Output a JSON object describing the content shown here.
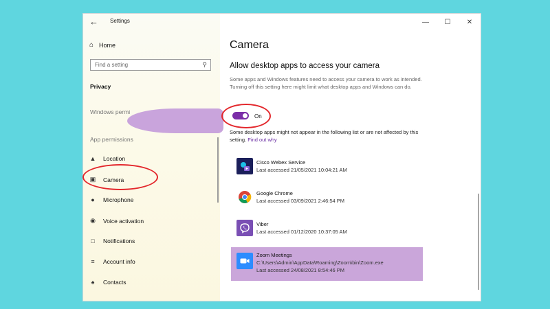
{
  "window": {
    "title": "Settings",
    "controls": {
      "minimize": "—",
      "maximize": "☐",
      "close": "✕"
    }
  },
  "sidebar": {
    "home_label": "Home",
    "search_placeholder": "Find a setting",
    "section_privacy": "Privacy",
    "section_windows_permissions": "Windows permi",
    "section_app_permissions": "App permissions",
    "items": [
      {
        "label": "Location",
        "icon": "location-icon"
      },
      {
        "label": "Camera",
        "icon": "camera-icon"
      },
      {
        "label": "Microphone",
        "icon": "microphone-icon"
      },
      {
        "label": "Voice activation",
        "icon": "voice-activation-icon"
      },
      {
        "label": "Notifications",
        "icon": "notifications-icon"
      },
      {
        "label": "Account info",
        "icon": "account-info-icon"
      },
      {
        "label": "Contacts",
        "icon": "contacts-icon"
      }
    ]
  },
  "main": {
    "title": "Camera",
    "heading": "Allow desktop apps to access your camera",
    "description": "Some apps and Windows features need to access your camera to work as intended. Turning off this setting here might limit what desktop apps and Windows can do.",
    "toggle_label": "On",
    "toggle_on": true,
    "note": "Some desktop apps might not appear in the following list or are not affected by this setting.",
    "note_link": "Find out why",
    "apps": [
      {
        "name": "Cisco Webex Service",
        "last_accessed": "Last accessed 21/05/2021 10:04:21 AM",
        "icon": "cisco-webex-icon",
        "color": "#1b1f5a"
      },
      {
        "name": "Google Chrome",
        "last_accessed": "Last accessed 03/09/2021 2:46:54 PM",
        "icon": "google-chrome-icon",
        "color": "#ffffff"
      },
      {
        "name": "Viber",
        "last_accessed": "Last accessed 01/12/2020 10:37:05 AM",
        "icon": "viber-icon",
        "color": "#7a4fb4"
      },
      {
        "name": "Zoom Meetings",
        "path": "C:\\Users\\Admin\\AppData\\Roaming\\Zoom\\bin\\Zoom.exe",
        "last_accessed": "Last accessed 24/08/2021 8:54:46 PM",
        "icon": "zoom-icon",
        "color": "#2d8cff"
      }
    ]
  },
  "colors": {
    "accent": "#7b2ea8",
    "link": "#6b2fa3",
    "annotation": "#e3272c",
    "highlight": "#caa6da",
    "background": "#5fd6df"
  }
}
